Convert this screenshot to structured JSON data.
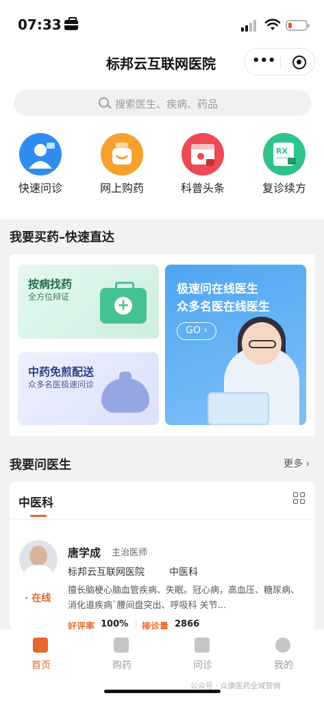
{
  "status": {
    "time": "07:33"
  },
  "header": {
    "title": "标邦云互联网医院"
  },
  "search": {
    "placeholder": "搜索医生、疾病、药品"
  },
  "quick_actions": [
    {
      "label": "快速问诊",
      "icon": "doctor-consult-icon",
      "color": "#2f8cf0"
    },
    {
      "label": "网上购药",
      "icon": "medicine-bag-icon",
      "color": "#f6a12d"
    },
    {
      "label": "科普头条",
      "icon": "news-calendar-icon",
      "color": "#ec4a55"
    },
    {
      "label": "复诊续方",
      "icon": "prescription-rx-icon",
      "color": "#2ec38a"
    }
  ],
  "buy_section": {
    "title": "我要买药–快速直达",
    "card_disease": {
      "title": "按病找药",
      "subtitle": "全方位辩证"
    },
    "card_herbal": {
      "title": "中药免煎配送",
      "subtitle": "众多名医极速问诊"
    },
    "card_online": {
      "line1": "极速问在线医生",
      "line2": "众多名医在线医生",
      "button": "GO"
    }
  },
  "doctor_section": {
    "title": "我要问医生",
    "more": "更多",
    "department": "中医科",
    "doctor": {
      "name": "唐学成",
      "title": "主治医师",
      "hospital": "标邦云互联网医院",
      "dept": "中医科",
      "status": "· 在线",
      "specialty": "擅长脑梗心脑血管疾病、失眠。冠心病，高血压、糖尿病、消化道疾病`腰间盘突出、呼吸科 关节...",
      "rating_label": "好评率",
      "rating_value": "100%",
      "consult_label": "接诊量",
      "consult_value": "2866"
    }
  },
  "tabbar": [
    {
      "label": "首页",
      "icon": "home-icon",
      "active": true
    },
    {
      "label": "购药",
      "icon": "medicine-icon",
      "active": false
    },
    {
      "label": "问诊",
      "icon": "chat-consult-icon",
      "active": false
    },
    {
      "label": "我的",
      "icon": "profile-icon",
      "active": false
    }
  ],
  "watermark": "公众号 · 众康医药全域营销"
}
